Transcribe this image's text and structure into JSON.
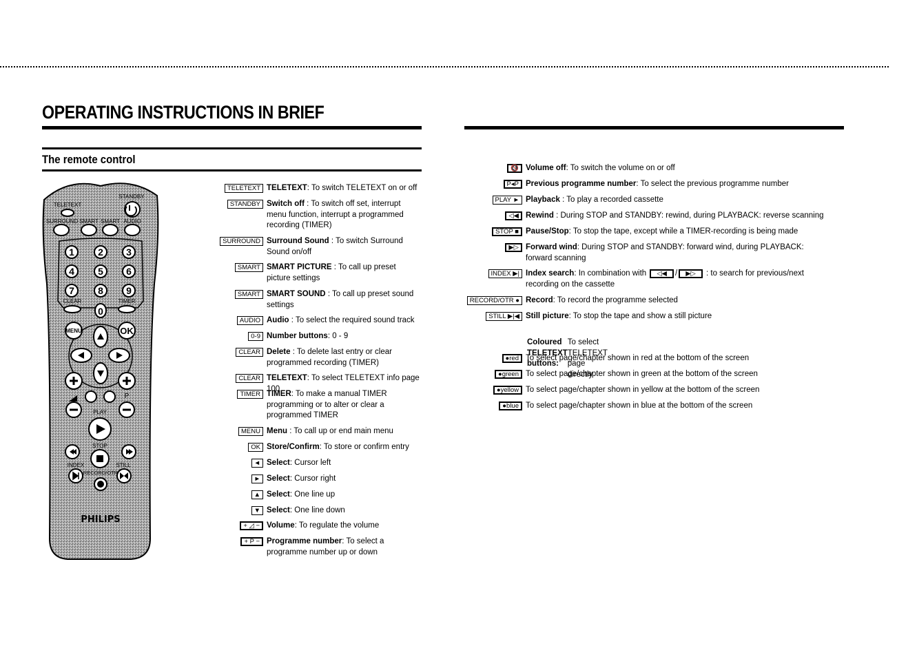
{
  "header": {
    "title": "OPERATING INSTRUCTIONS IN BRIEF",
    "subtitle": "The remote control"
  },
  "remote": {
    "brand": "PHILIPS",
    "labels": {
      "teletext": "TELETEXT",
      "standby": "STANDBY",
      "surround": "SURROUND",
      "smart1": "SMART",
      "smart2": "SMART",
      "audio": "AUDIO",
      "clear": "CLEAR",
      "timer": "TIMER",
      "menu": "MENU",
      "ok": "OK",
      "play": "PLAY",
      "stop": "STOP",
      "index": "INDEX",
      "still": "STILL",
      "record": "RECORD/OTR",
      "p": "P"
    },
    "digits": [
      "1",
      "2",
      "3",
      "4",
      "5",
      "6",
      "7",
      "8",
      "9",
      "0"
    ]
  },
  "left_items": [
    {
      "key": "TELETEXT",
      "icon": "teletext-icon",
      "term": "TELETEXT",
      "text": ": To switch TELETEXT on or off"
    },
    {
      "key": "STANDBY",
      "icon": "power-icon",
      "term": "Switch off",
      "text": " : To switch off set, interrupt menu function, interrupt a programmed recording (TIMER)"
    },
    {
      "key": "SURROUND",
      "icon": "",
      "term": "Surround Sound",
      "text": " : To switch Surround Sound on/off"
    },
    {
      "key": "SMART",
      "icon": "",
      "term": "SMART PICTURE",
      "text": " : To call up preset picture settings"
    },
    {
      "key": "SMART",
      "icon": "note-icon",
      "term": "SMART SOUND",
      "text": " : To call up preset sound settings"
    },
    {
      "key": "AUDIO",
      "icon": "",
      "term": "Audio",
      "text": " : To select the required sound track"
    },
    {
      "key": "0-9",
      "icon": "",
      "term": "Number buttons",
      "text": ": 0 - 9"
    },
    {
      "key": "CLEAR",
      "icon": "",
      "term": "Delete",
      "text": " : To delete last entry or clear programmed recording (TIMER)"
    },
    {
      "key": "CLEAR",
      "icon": "",
      "term": "TELETEXT",
      "text": ": To select TELETEXT info page 100"
    },
    {
      "key": "TIMER",
      "icon": "clock-icon",
      "term": "TIMER",
      "text": ": To make a manual TIMER programming or to alter or clear a programmed TIMER"
    },
    {
      "key": "MENU",
      "icon": "",
      "term": "Menu",
      "text": " : To call up or end main menu"
    },
    {
      "key": "OK",
      "icon": "",
      "term": "Store/Confirm",
      "text": ": To store or confirm entry"
    },
    {
      "key": "◄",
      "icon": "arrow-left-icon",
      "term": "Select",
      "text": ": Cursor left"
    },
    {
      "key": "►",
      "icon": "arrow-right-icon",
      "term": "Select",
      "text": ": Cursor right"
    },
    {
      "key": "▲",
      "icon": "arrow-up-icon",
      "term": "Select",
      "text": ": One line up"
    },
    {
      "key": "▼",
      "icon": "arrow-down-icon",
      "term": "Select",
      "text": ": One line down"
    },
    {
      "key": "+ ◿ −",
      "icon": "volume-icon",
      "term": "Volume",
      "text": ": To regulate the volume"
    },
    {
      "key": "+ P −",
      "icon": "programme-icon",
      "term": "Programme number",
      "text": ": To select a programme number up or down"
    }
  ],
  "right_items": [
    {
      "key": "🔇",
      "icon": "mute-icon",
      "term": "Volume off",
      "text": ": To switch the volume on or off"
    },
    {
      "key": "P◂P",
      "icon": "previous-programme-icon",
      "term": "Previous programme number",
      "text": ": To select the previous programme number"
    },
    {
      "key": "PLAY ►",
      "icon": "play-icon",
      "term": "Playback",
      "text": " : To play a recorded cassette"
    },
    {
      "key": "◁◀",
      "icon": "rewind-icon",
      "term": "Rewind",
      "text": " : During STOP and STANDBY: rewind, during PLAYBACK: reverse scanning"
    },
    {
      "key": "STOP ■",
      "icon": "stop-icon",
      "term": "Pause/Stop",
      "text": ": To stop the tape, except while a TIMER-recording is being made"
    },
    {
      "key": "▶▷",
      "icon": "forward-icon",
      "term": "Forward wind",
      "text": ": During STOP and STANDBY: forward wind, during PLAYBACK: forward scanning"
    },
    {
      "key": "INDEX ▶|",
      "icon": "index-icon",
      "term": "Index search",
      "text_before": ": In combination with ",
      "inline_keys": [
        "◁◀",
        "▶▷"
      ],
      "separator": "/",
      "text": " : to search for previous/next recording on the cassette"
    },
    {
      "key": "RECORD/OTR ●",
      "icon": "record-icon",
      "term": "Record",
      "text": ": To record the programme selected"
    },
    {
      "key": "STILL ▶|◀",
      "icon": "still-icon",
      "term": "Still picture",
      "text": ": To stop the tape and show a still picture"
    }
  ],
  "coloured": {
    "term": "Coloured TELETEXT buttons:",
    "text": "To select TELETEXT page directly",
    "items": [
      {
        "key": "red",
        "text": "To select page/chapter shown in red at the bottom of the screen"
      },
      {
        "key": "green",
        "text": "To select page/chapter shown in green at the bottom of the screen"
      },
      {
        "key": "yellow",
        "text": "To select page/chapter shown in yellow at the bottom of the screen"
      },
      {
        "key": "blue",
        "text": "To select page/chapter shown in blue at the bottom of the screen"
      }
    ]
  }
}
